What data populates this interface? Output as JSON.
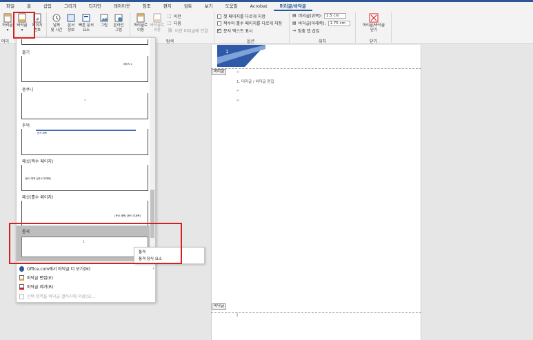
{
  "tabs": [
    "파일",
    "홈",
    "삽입",
    "그리기",
    "디자인",
    "레이아웃",
    "참조",
    "편지",
    "검토",
    "보기",
    "도움말",
    "Acrobat",
    "머리글/바닥글"
  ],
  "ribbon": {
    "header_btn": "머리글",
    "footer_btn": "바닥글",
    "pagenum_btn_1": "페이지",
    "pagenum_btn_2": "번호",
    "date_btn_1": "날짜",
    "date_btn_2": "및 시간",
    "docinfo_btn_1": "문서",
    "docinfo_btn_2": "정보",
    "quickparts_btn_1": "빠른 문서",
    "quickparts_btn_2": "요소",
    "picture_btn": "그림",
    "online_btn_1": "온라인",
    "online_btn_2": "그림",
    "goto_header_1": "머리글로",
    "goto_header_2": "이동",
    "goto_footer_1": "바닥글로",
    "goto_footer_2": "이동",
    "prev": "이전",
    "next": "다음",
    "link_prev": "이전 머리글에 연결",
    "nav_group": "탐색",
    "opt1": "첫 페이지를 다르게 지정",
    "opt2": "짝수와 홀수 페이지를 다르게 지정",
    "opt3": "문서 텍스트 표시",
    "options_group": "옵션",
    "hdr_top_label": "머리글(위쪽):",
    "hdr_top_value": "1.5 cm",
    "ftr_bottom_label": "바닥글(아래쪽):",
    "ftr_bottom_value": "1.75 cm",
    "align_tab": "맞춤 탭 삽입",
    "position_group": "위치",
    "close_1": "머리글/바닥글",
    "close_2": "닫기",
    "close_group": "닫기",
    "group_left": "머리"
  },
  "gallery": [
    {
      "title": "줄기",
      "sample": "페이지 1"
    },
    {
      "title": "중쿠니",
      "sample": "1"
    },
    {
      "title": "추억",
      "sample": "문서 제목"
    },
    {
      "title": "패싯(짝수 페이지)",
      "sample": "[문서 제목] [문서 부제목]"
    },
    {
      "title": "패싯(홀수 페이지)",
      "sample": "[문서 제목] [문서 부제목]"
    },
    {
      "title": "통격",
      "sample": "1"
    }
  ],
  "menu": {
    "more": "Office.com에서 바닥글 더 보기(M)",
    "edit": "바닥글 편집(E)",
    "remove": "바닥글 제거(R)",
    "save": "선택 영역을 바닥글 갤러리에 저장(S)..."
  },
  "context": {
    "item1": "통격",
    "item2": "통격 장식 요소"
  },
  "page": {
    "header_tag": "머리글",
    "footer_tag": "바닥글",
    "page_number": "1",
    "body_line": "1. 머리글 / 바닥글 편집"
  },
  "colors": {
    "accent": "#2b579a",
    "highlight": "#d62020"
  }
}
